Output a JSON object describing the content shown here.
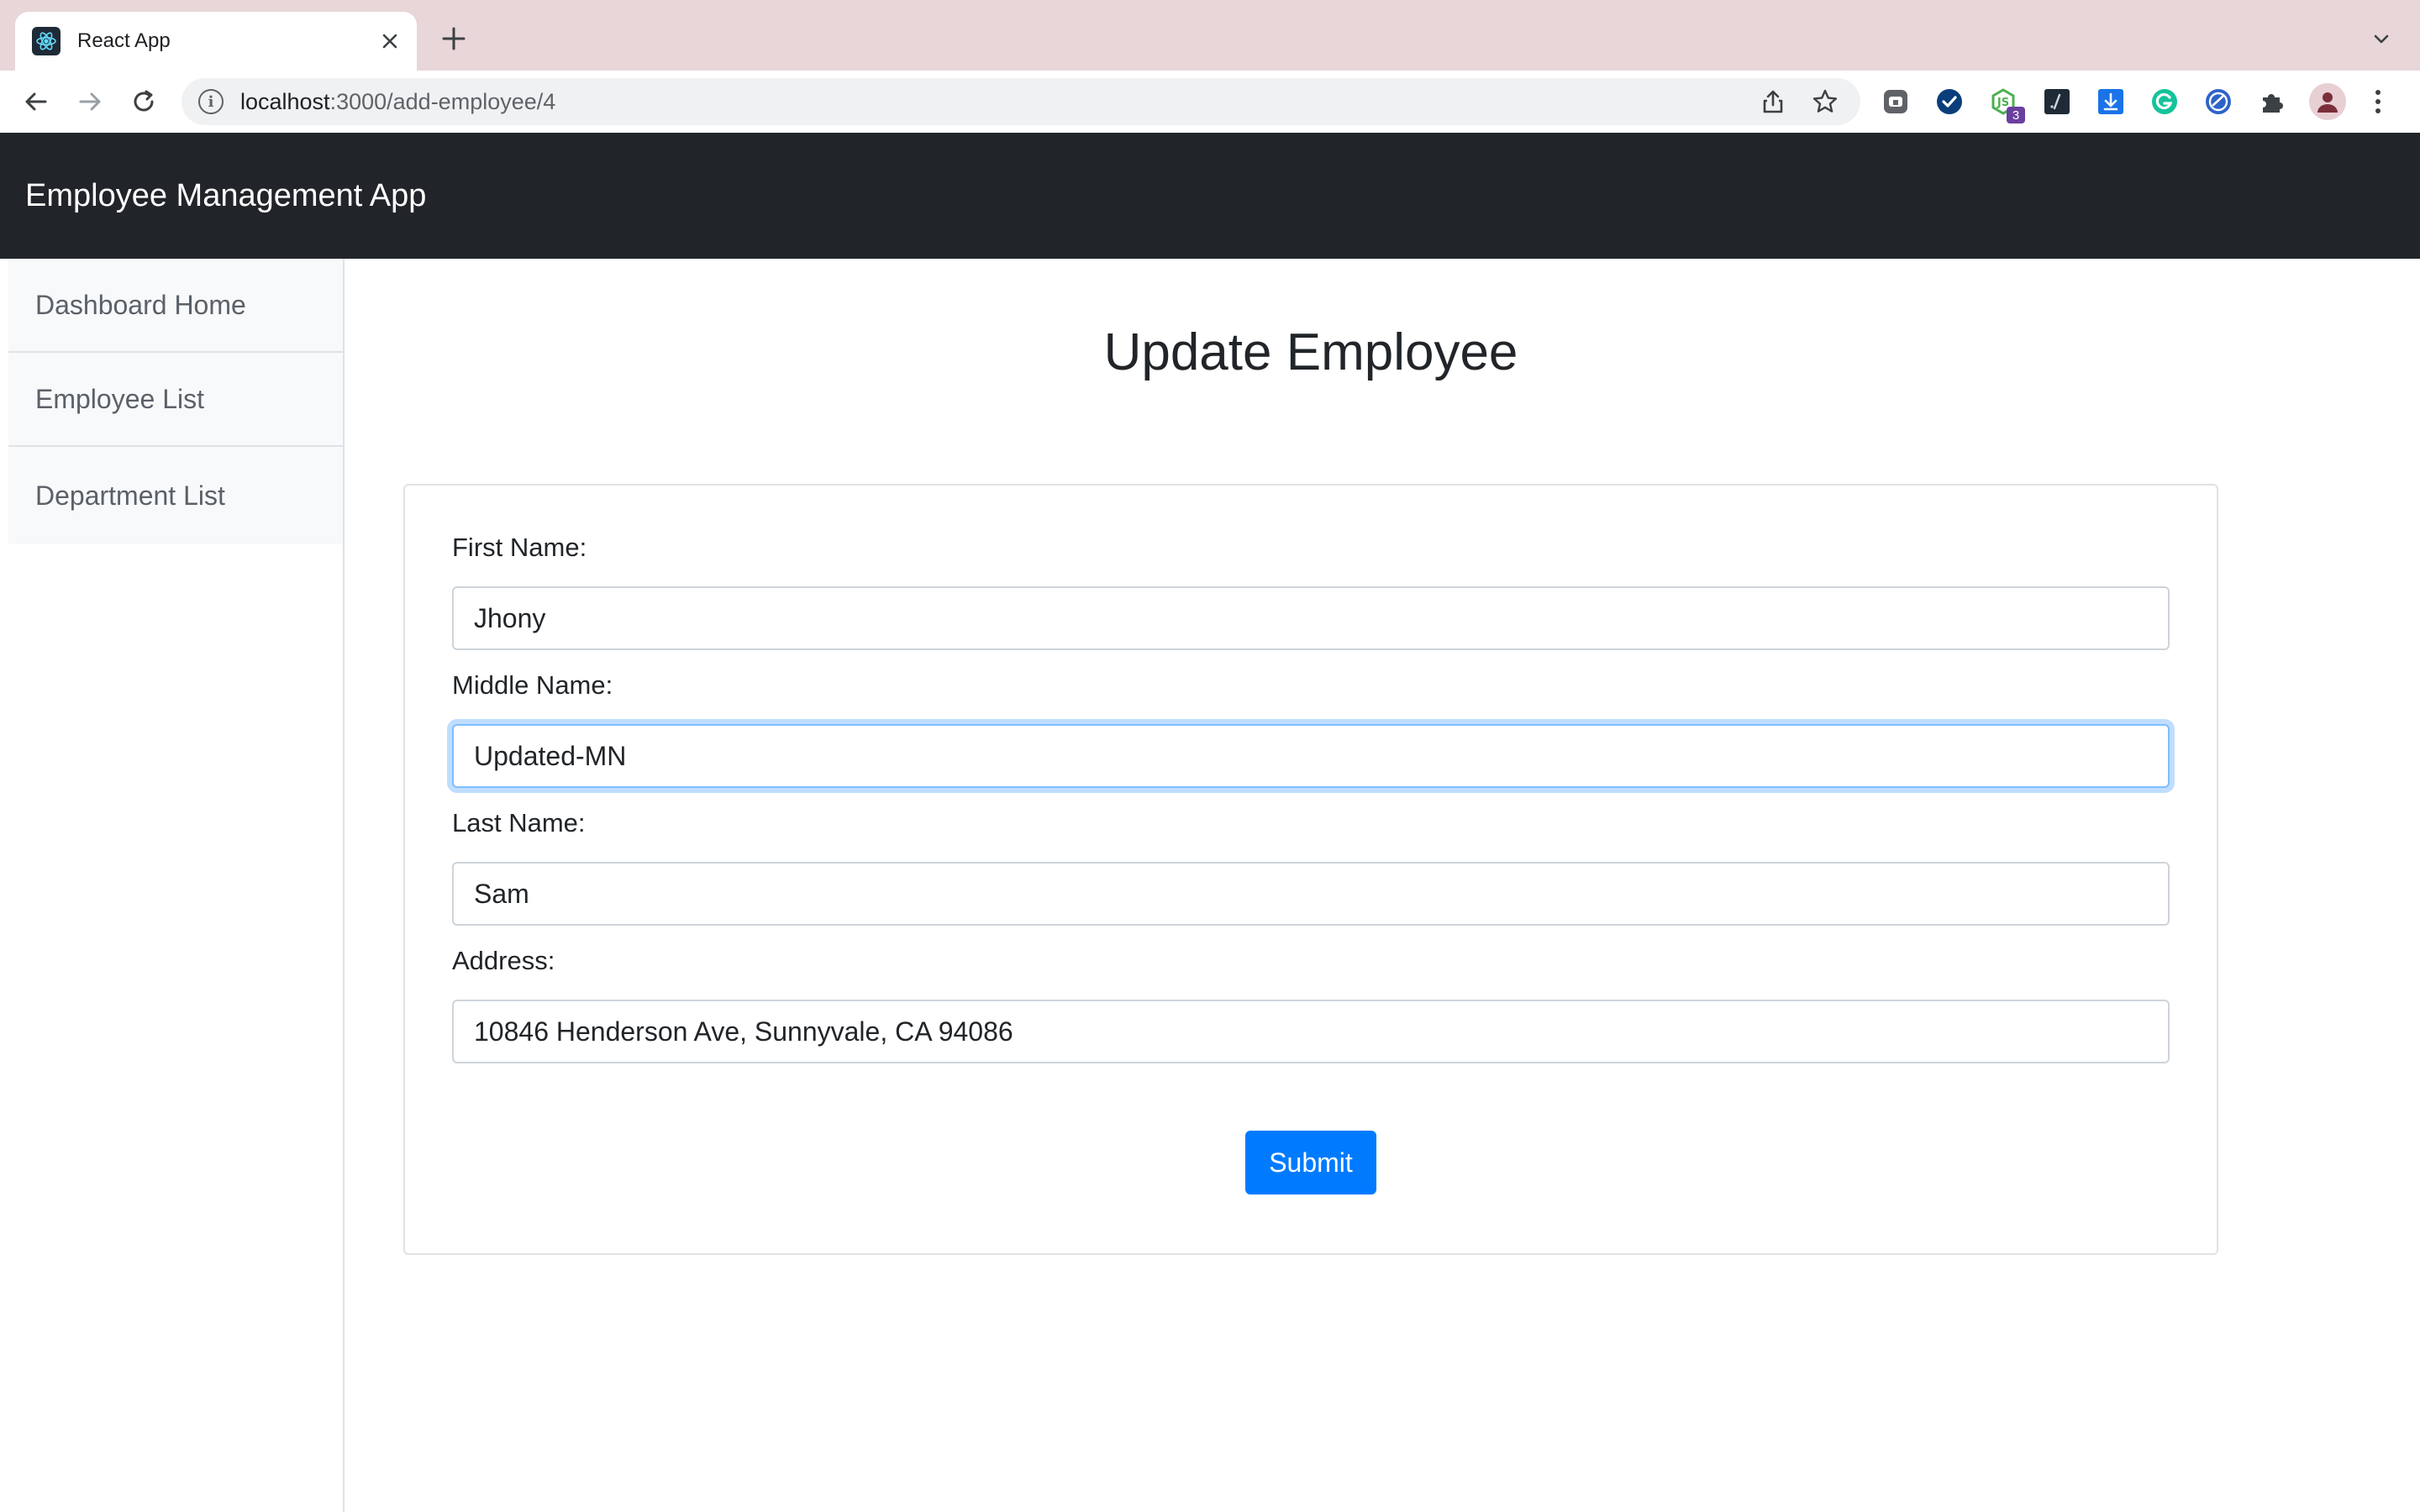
{
  "browser": {
    "tab": {
      "title": "React App",
      "favicon": "react-logo-icon"
    },
    "url": {
      "host": "localhost",
      "path": ":3000/add-employee/4"
    },
    "extensions": [
      {
        "icon": "extension-ghost-icon"
      },
      {
        "icon": "extension-check-icon"
      },
      {
        "icon": "extension-node-icon",
        "badge": "3"
      },
      {
        "icon": "extension-terminal-icon"
      },
      {
        "icon": "extension-download-icon"
      },
      {
        "icon": "grammarly-icon"
      },
      {
        "icon": "extension-edge-icon"
      },
      {
        "icon": "puzzle-icon"
      }
    ]
  },
  "navbar": {
    "brand": "Employee Management App"
  },
  "sidebar": {
    "items": [
      {
        "label": "Dashboard Home"
      },
      {
        "label": "Employee List"
      },
      {
        "label": "Department List"
      }
    ]
  },
  "page": {
    "title": "Update Employee"
  },
  "form": {
    "fields": [
      {
        "label": "First Name:",
        "value": "Jhony"
      },
      {
        "label": "Middle Name:",
        "value": "Updated-MN"
      },
      {
        "label": "Last Name:",
        "value": "Sam"
      },
      {
        "label": "Address:",
        "value": "10846 Henderson Ave, Sunnyvale, CA 94086"
      }
    ],
    "submit_label": "Submit"
  },
  "colors": {
    "navbar_bg": "#212529",
    "primary": "#007bff",
    "tabstrip_bg": "#e8d6d9"
  }
}
